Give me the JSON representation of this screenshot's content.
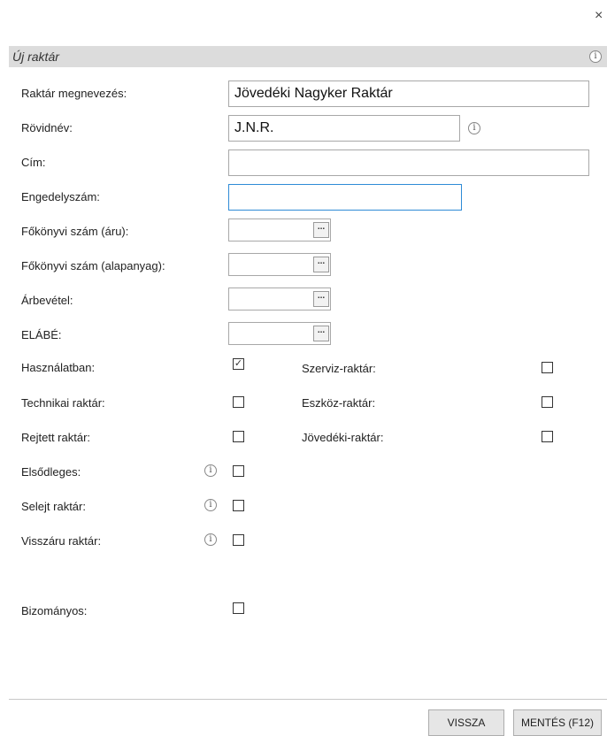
{
  "window": {
    "close_glyph": "×"
  },
  "header": {
    "title": "Új raktár",
    "info_glyph": "i"
  },
  "form": {
    "name": {
      "label": "Raktár megnevezés:",
      "value": "Jövedéki Nagyker Raktár"
    },
    "short": {
      "label": "Rövidnév:",
      "value": "J.N.R.",
      "info_glyph": "i"
    },
    "address": {
      "label": "Cím:",
      "value": ""
    },
    "license": {
      "label": "Engedelyszám:",
      "value": ""
    },
    "ledger_goods": {
      "label": "Főkönyvi szám (áru):",
      "button_glyph": "..."
    },
    "ledger_material": {
      "label": "Főkönyvi szám (alapanyag):",
      "button_glyph": "..."
    },
    "revenue": {
      "label": "Árbevétel:",
      "button_glyph": "..."
    },
    "elabe": {
      "label": "ELÁBÉ:",
      "button_glyph": "..."
    }
  },
  "checks": {
    "in_use": {
      "label": "Használatban:",
      "checked": true,
      "mark": "✓"
    },
    "service": {
      "label": "Szerviz-raktár:",
      "checked": false
    },
    "technical": {
      "label": "Technikai raktár:",
      "checked": false
    },
    "tool": {
      "label": "Eszköz-raktár:",
      "checked": false
    },
    "hidden": {
      "label": "Rejtett raktár:",
      "checked": false
    },
    "excise": {
      "label": "Jövedéki-raktár:",
      "checked": false
    },
    "primary": {
      "label": "Elsődleges:",
      "checked": false,
      "info_glyph": "i"
    },
    "scrap": {
      "label": "Selejt raktár:",
      "checked": false,
      "info_glyph": "i"
    },
    "returns": {
      "label": "Visszáru raktár:",
      "checked": false,
      "info_glyph": "i"
    },
    "consignment": {
      "label": "Bizományos:",
      "checked": false
    }
  },
  "footer": {
    "back_label": "VISSZA",
    "save_label": "MENTÉS (F12)"
  },
  "colors": {
    "header_bg": "#dcdcdc",
    "focus_border": "#2e8bd6",
    "button_bg": "#e6e6e6"
  }
}
